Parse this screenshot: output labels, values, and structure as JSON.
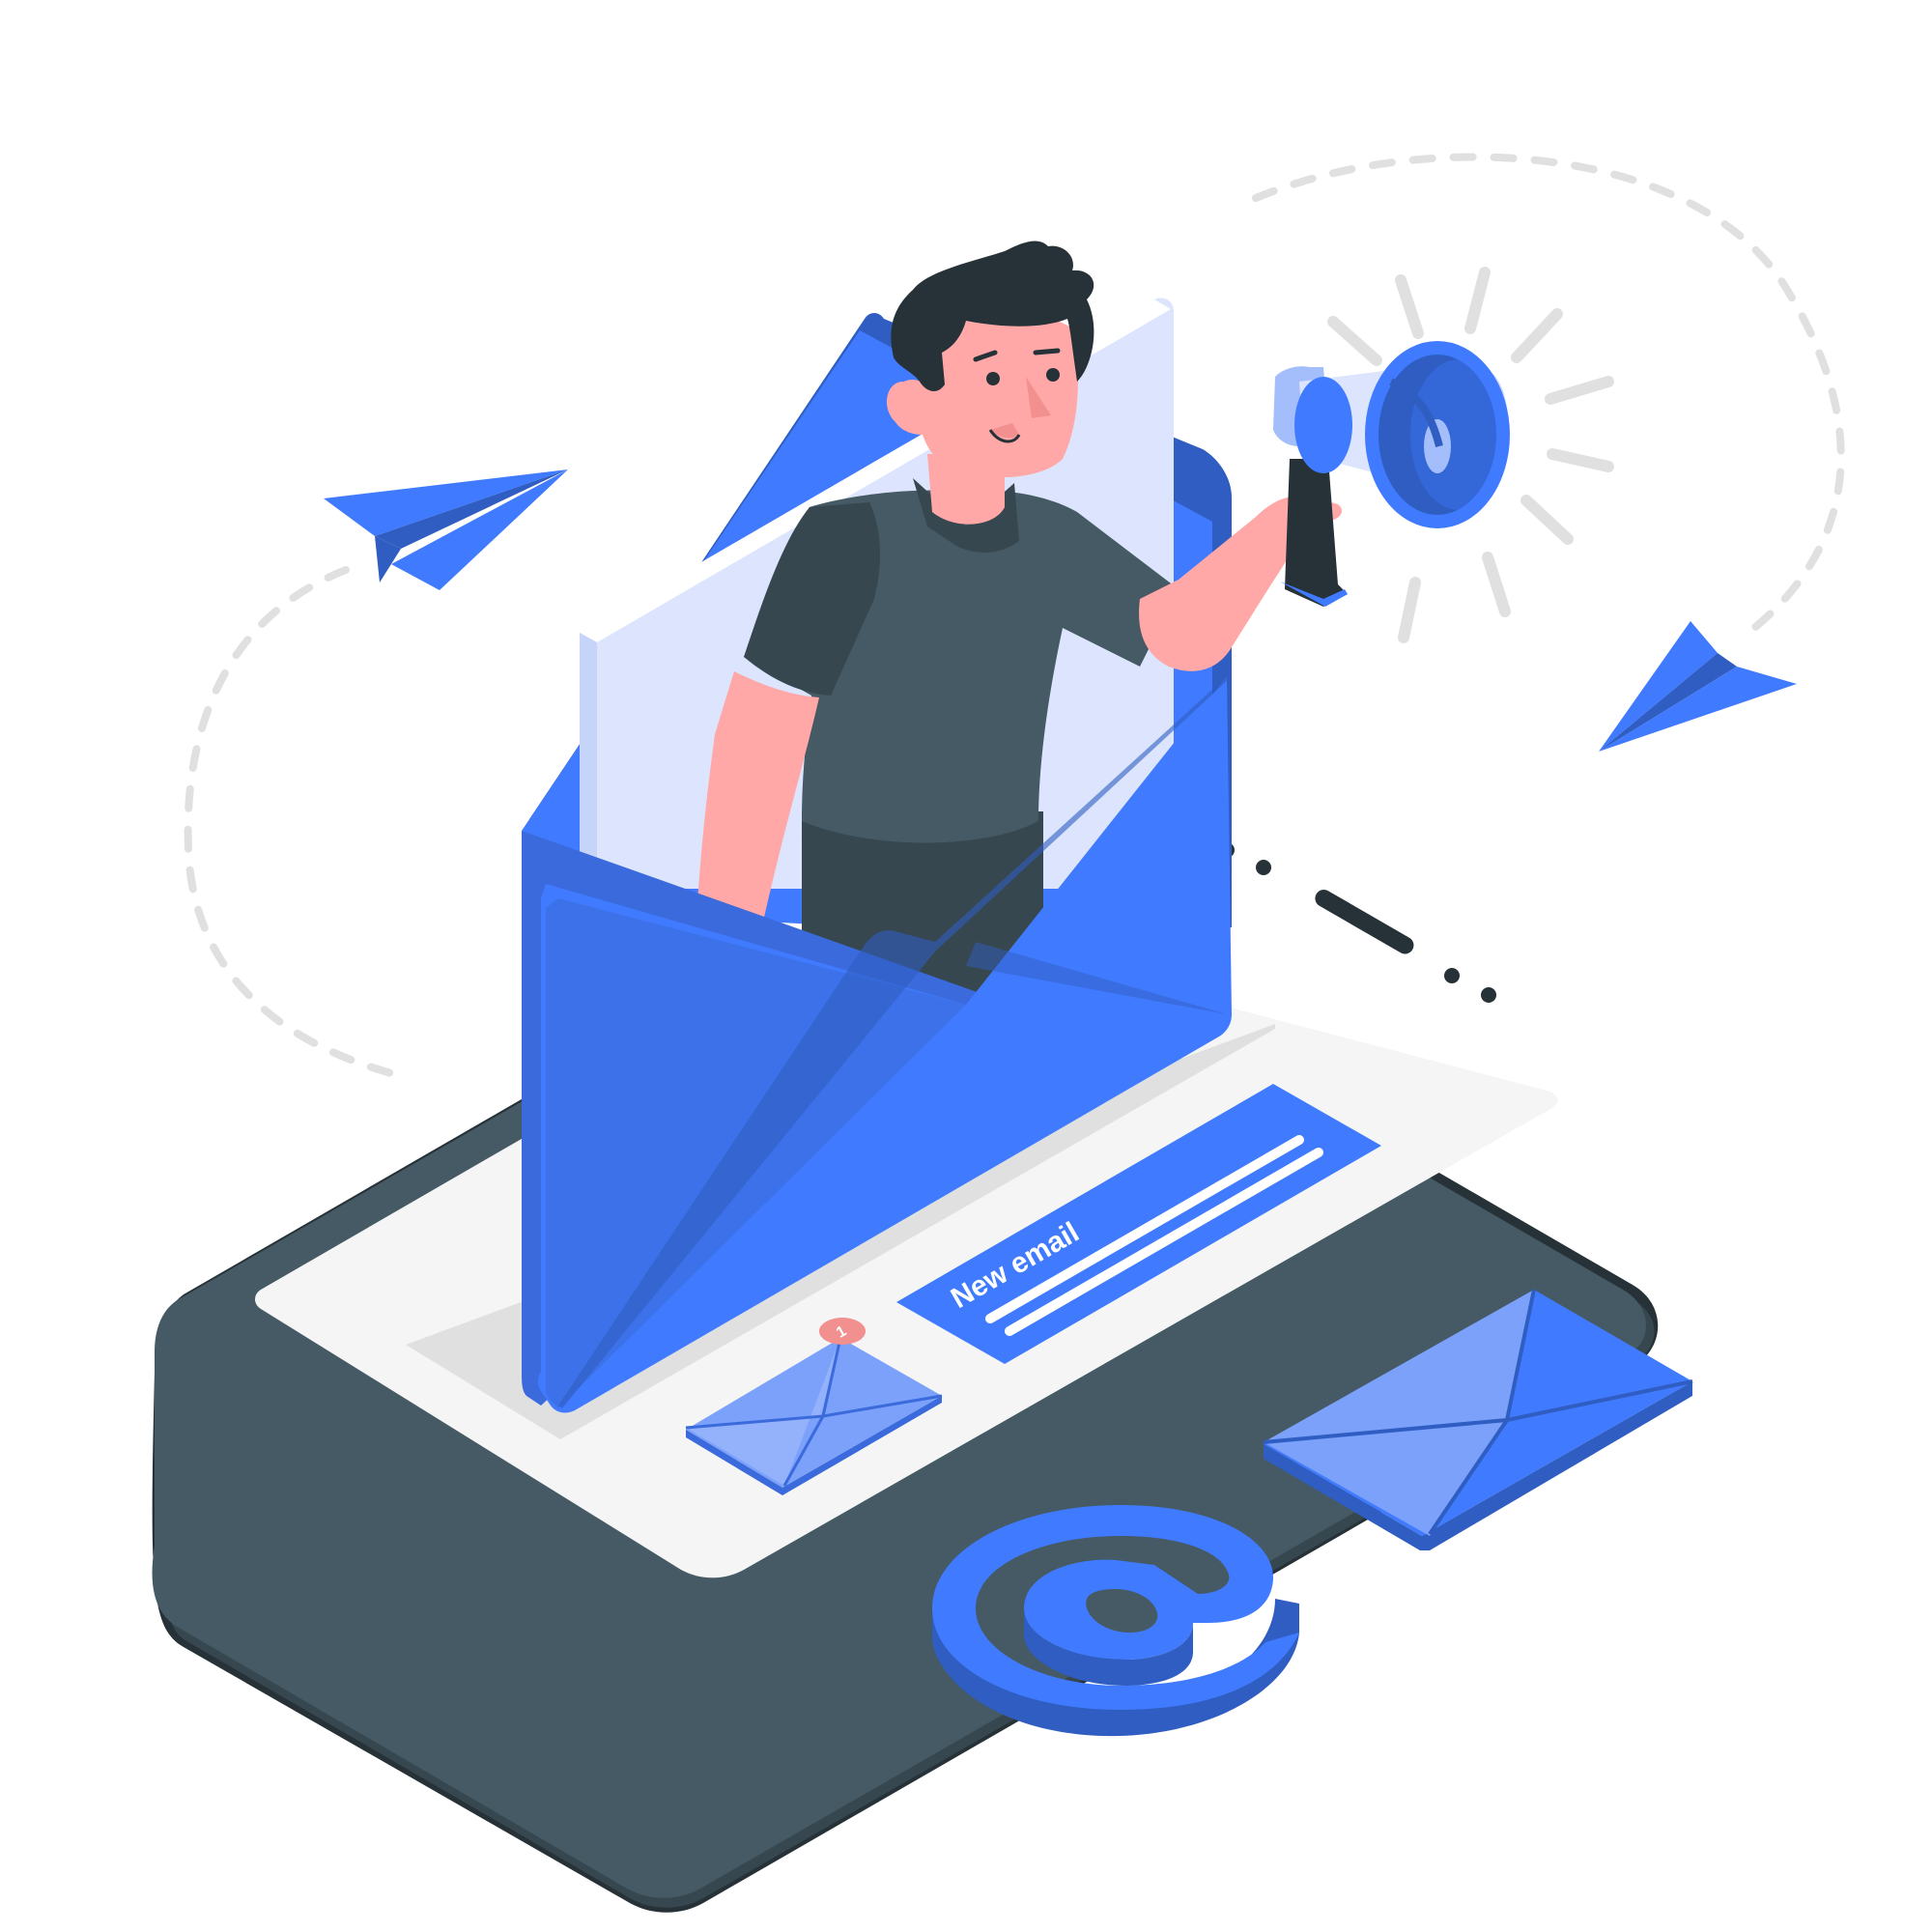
{
  "banner": {
    "label": "New email"
  },
  "notification": {
    "count": "1"
  },
  "colors": {
    "primary": "#407BFF",
    "primary_dark": "#2F5DC2",
    "primary_mid": "#3A6ADB",
    "primary_light": "#7BA1FB",
    "primary_pale": "#A3BEFB",
    "paper": "#DCE5FD",
    "device_dark": "#263238",
    "device_mid": "#455A64",
    "screen": "#F5F5F5",
    "skin": "#FFA8A7",
    "hair": "#263238",
    "shirt": "#455A64",
    "badge": "#F28F8F",
    "dash": "#E0E0E0"
  },
  "icons": {
    "megaphone": "megaphone-icon",
    "at_sign": "at-sign-icon",
    "envelope": "envelope-icon",
    "paper_plane": "paper-plane-icon"
  }
}
